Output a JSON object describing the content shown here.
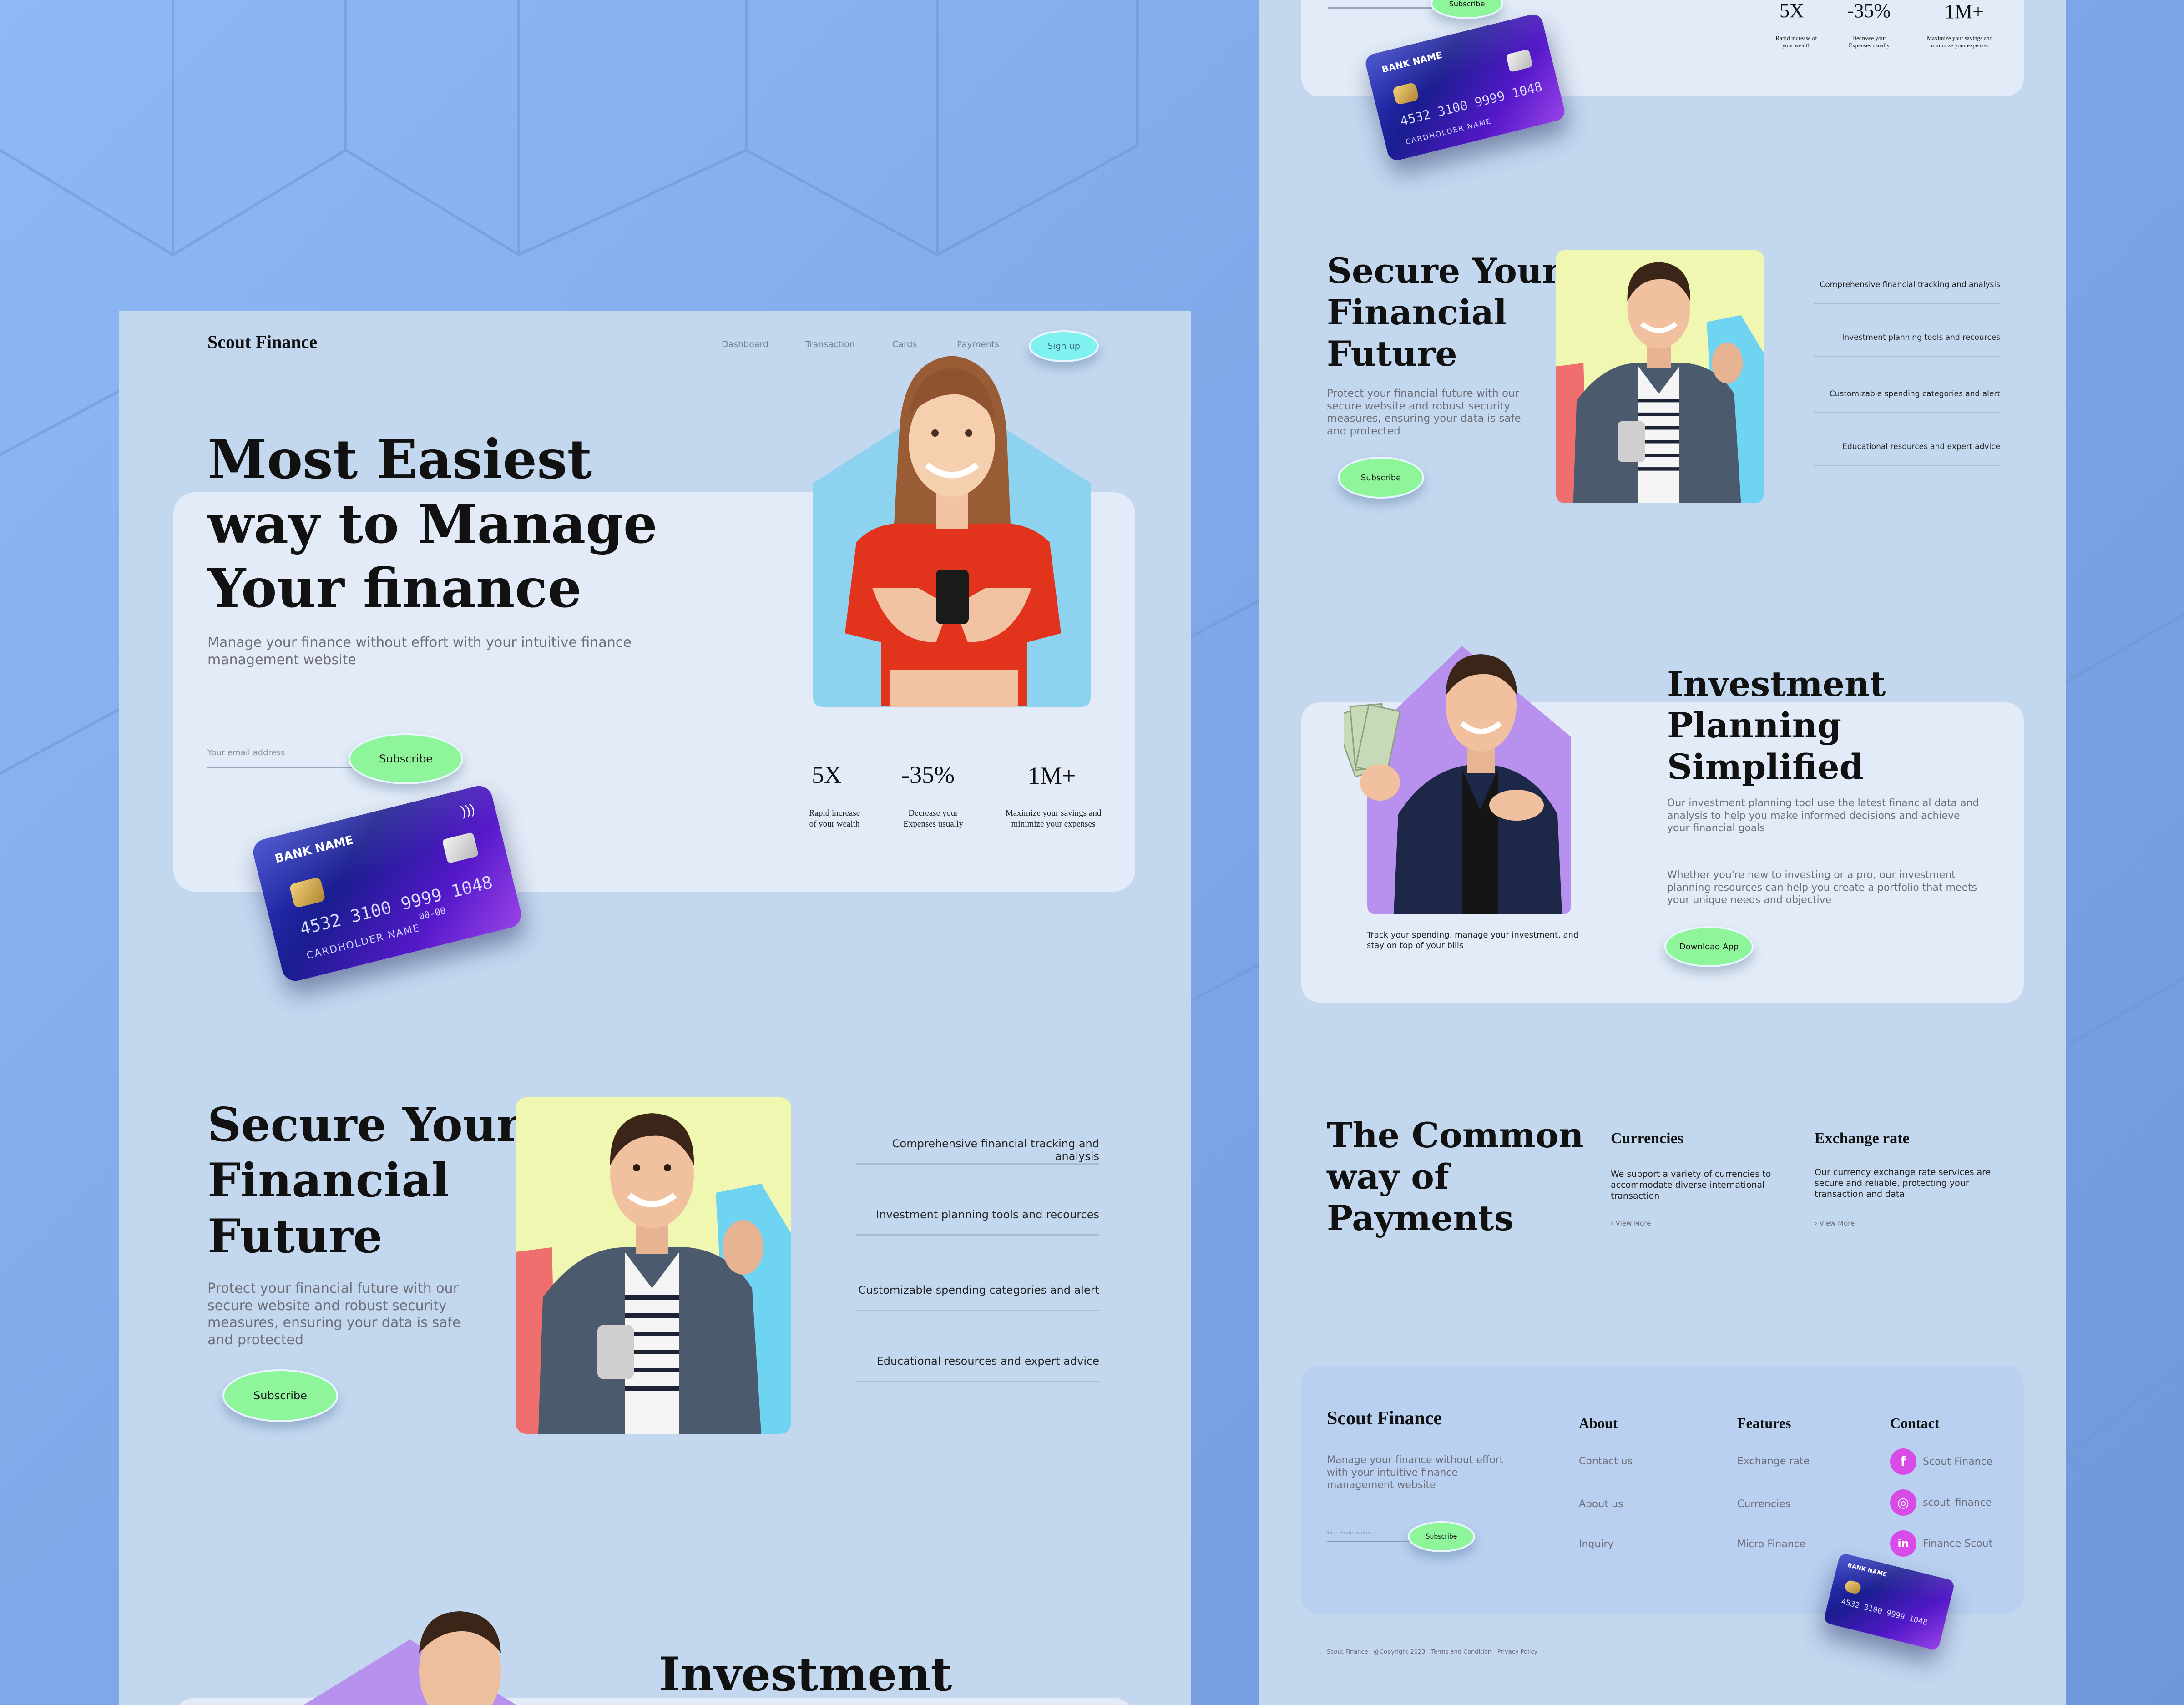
{
  "colors": {
    "background": "#7ea8e9",
    "panel": "#c3d7ef",
    "card": "#e2ebf7",
    "accent_green": "#8ff59a",
    "signup_cyan": "#7ff1ee",
    "social_pink": "#d84be6"
  },
  "nav": {
    "logo": "Scout Finance",
    "links": [
      "Dashboard",
      "Transaction",
      "Cards",
      "Payments"
    ],
    "signup": "Sign up"
  },
  "hero": {
    "title_lines": [
      "Most Easiest",
      "way to Manage",
      "Your finance"
    ],
    "subtitle": "Manage your finance without effort with your intuitive finance management website",
    "email_placeholder": "Your email address",
    "subscribe": "Subscribe",
    "stats": [
      {
        "value": "5X",
        "label": "Rapid increase of your wealth"
      },
      {
        "value": "-35%",
        "label": "Decrease your Expenses usually"
      },
      {
        "value": "1M+",
        "label": "Maximize your savings and minimize your expenses"
      }
    ]
  },
  "card": {
    "bank_name": "BANK NAME",
    "number": "4532 3100 9999 1048",
    "small_number": "4532",
    "expiry": "00-00",
    "holder": "CARDHOLDER NAME"
  },
  "secure": {
    "title_lines": [
      "Secure Your",
      "Financial",
      "Future"
    ],
    "description": "Protect your financial future with our secure website and robust security measures, ensuring your data is safe and protected",
    "subscribe": "Subscribe",
    "features": [
      "Comprehensive financial tracking and analysis",
      "Investment planning tools and recources",
      "Customizable spending categories and alert",
      "Educational resources and expert advice"
    ]
  },
  "investment": {
    "title_lines": [
      "Investment",
      "Planning",
      "Simplified"
    ],
    "left_title_partial": "Investment",
    "paragraph1": "Our investment planning tool use the latest financial data and analysis to help you make informed decisions and achieve your financial goals",
    "paragraph2": "Whether you're new to investing or a pro, our investment planning resources can help you create a portfolio that meets your unique needs and objective",
    "caption": "Track your spending, manage your investment, and stay on top of your bills",
    "download": "Download App"
  },
  "payments": {
    "title_lines": [
      "The Common",
      "way of",
      "Payments"
    ],
    "columns": [
      {
        "title": "Currencies",
        "text": "We support a variety of currencies to accommodate diverse international transaction",
        "link": "View More"
      },
      {
        "title": "Exchange rate",
        "text": "Our currency exchange rate services are secure and reliable, protecting your transaction and data",
        "link": "View More"
      }
    ]
  },
  "footer": {
    "logo": "Scout Finance",
    "description": "Manage your finance without effort with your intuitive finance management website",
    "email_placeholder": "Your email address",
    "subscribe": "Subscribe",
    "about": {
      "title": "About",
      "links": [
        "Contact us",
        "About us",
        "Inquiry"
      ]
    },
    "features": {
      "title": "Features",
      "links": [
        "Exchange rate",
        "Currencies",
        "Micro Finance"
      ]
    },
    "contact": {
      "title": "Contact",
      "items": [
        {
          "icon": "facebook-icon",
          "glyph": "f",
          "label": "Scout Finance"
        },
        {
          "icon": "instagram-icon",
          "glyph": "◎",
          "label": "scout_finance"
        },
        {
          "icon": "linkedin-icon",
          "glyph": "in",
          "label": "Finance Scout"
        }
      ]
    },
    "bottom": [
      "Scout Finance",
      "@Copyright 2023",
      "Terms and Condition",
      "Privacy Policy"
    ]
  }
}
